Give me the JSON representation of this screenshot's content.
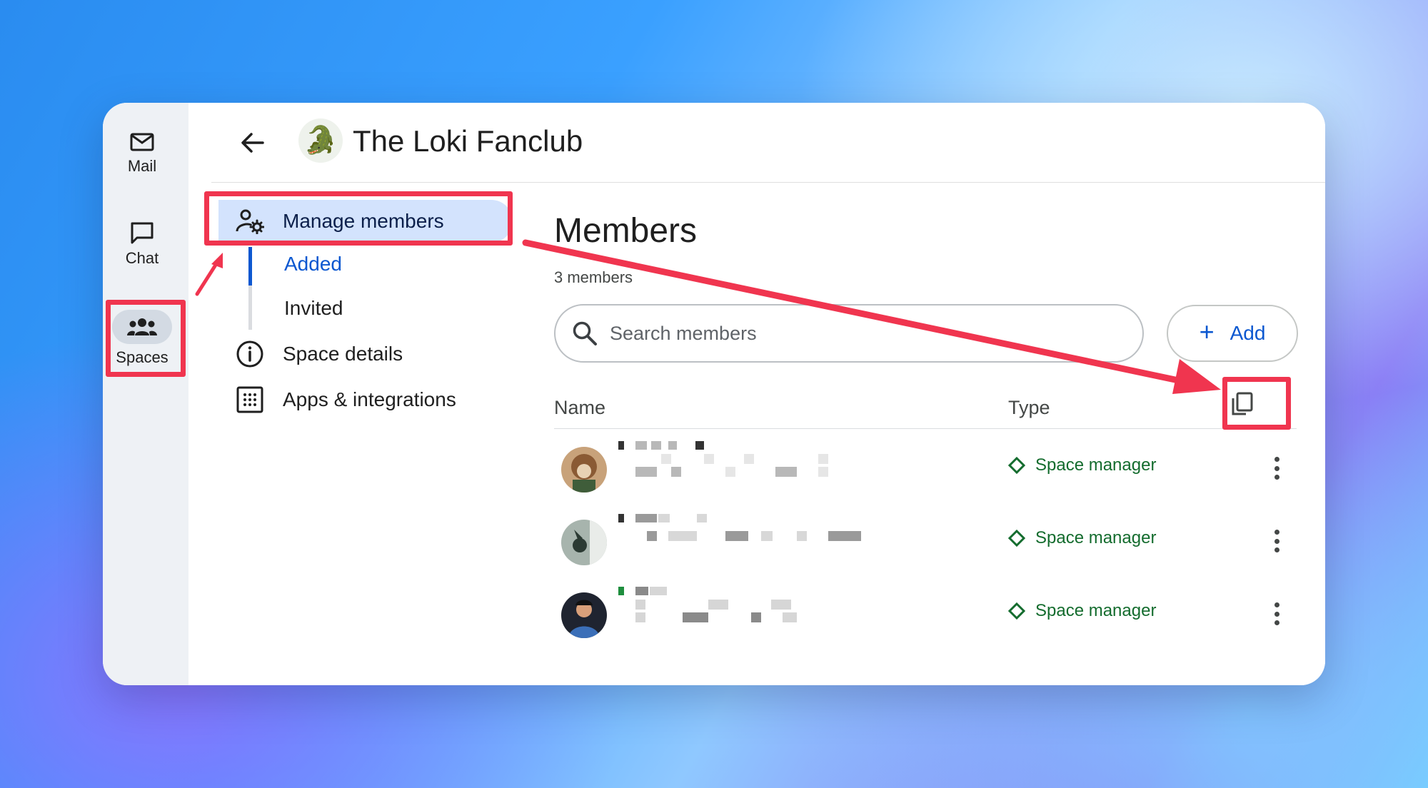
{
  "rail": {
    "mail_label": "Mail",
    "chat_label": "Chat",
    "spaces_label": "Spaces"
  },
  "header": {
    "space_title": "The Loki Fanclub",
    "space_emoji": "🐊"
  },
  "nav": {
    "manage_members": "Manage members",
    "added": "Added",
    "invited": "Invited",
    "space_details": "Space details",
    "apps_integrations": "Apps & integrations"
  },
  "members": {
    "title": "Members",
    "count": "3 members",
    "search_placeholder": "Search members",
    "add_label": "Add",
    "col_name": "Name",
    "col_type": "Type",
    "rows": [
      {
        "type": "Space manager"
      },
      {
        "type": "Space manager"
      },
      {
        "type": "Space manager"
      }
    ]
  },
  "colors": {
    "accent_blue": "#0b57d0",
    "active_nav_bg": "#d3e3fd",
    "manager_green": "#146c2e",
    "annotation_red": "#f0354f"
  }
}
